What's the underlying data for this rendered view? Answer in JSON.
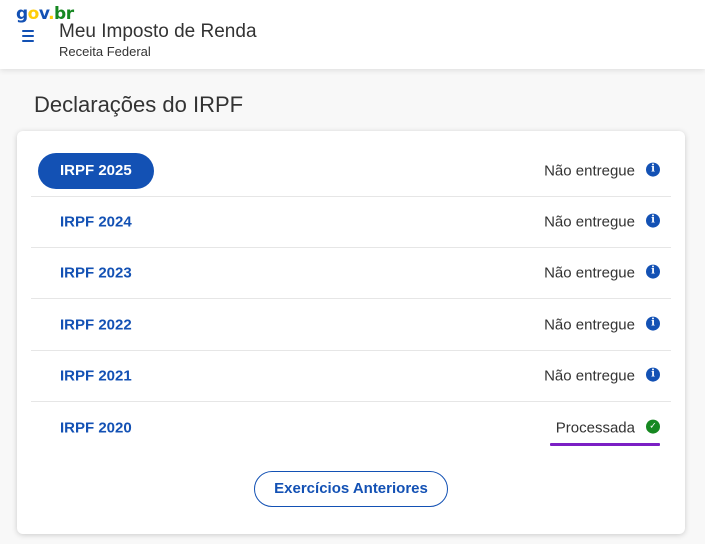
{
  "header": {
    "logo": {
      "g": "g",
      "o": "o",
      "v": "v",
      "dot": ".",
      "br": "br"
    },
    "app_title": "Meu Imposto de Renda",
    "app_subtitle": "Receita Federal"
  },
  "page": {
    "title": "Declarações do IRPF"
  },
  "declarations": [
    {
      "year_label": "IRPF 2025",
      "status": "Não entregue",
      "status_icon": "info-icon",
      "active": true
    },
    {
      "year_label": "IRPF 2024",
      "status": "Não entregue",
      "status_icon": "info-icon"
    },
    {
      "year_label": "IRPF 2023",
      "status": "Não entregue",
      "status_icon": "info-icon"
    },
    {
      "year_label": "IRPF 2022",
      "status": "Não entregue",
      "status_icon": "info-icon"
    },
    {
      "year_label": "IRPF 2021",
      "status": "Não entregue",
      "status_icon": "info-icon"
    },
    {
      "year_label": "IRPF 2020",
      "status": "Processada",
      "status_icon": "check-circle-icon"
    }
  ],
  "icons": {
    "info": "i",
    "check": "✓",
    "menu": "menu-icon"
  },
  "buttons": {
    "previous_years": "Exercícios Anteriores"
  },
  "colors": {
    "primary": "#1351b4",
    "success": "#168821",
    "highlight": "#7b1fc4"
  }
}
